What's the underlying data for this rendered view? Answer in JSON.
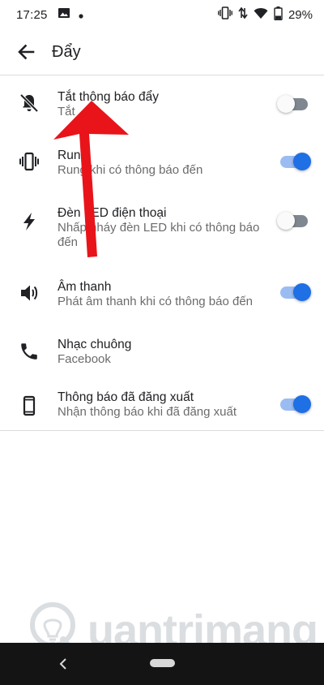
{
  "status_bar": {
    "time": "17:25",
    "left_icons": [
      "image-icon",
      "dot-icon"
    ],
    "right_icons": [
      "vibrate-icon",
      "data-arrows-icon",
      "wifi-icon",
      "battery-icon"
    ],
    "battery": "29%"
  },
  "app_bar": {
    "title": "Đẩy",
    "back_icon": "back-arrow-icon"
  },
  "settings": [
    {
      "icon": "bell-off-icon",
      "title": "Tắt thông báo đẩy",
      "subtitle": "Tắt",
      "toggle": "off"
    },
    {
      "icon": "vibrate-icon",
      "title": "Rung",
      "subtitle": "Rung khi có thông báo đến",
      "toggle": "on"
    },
    {
      "icon": "flash-icon",
      "title": "Đèn LED điện thoại",
      "subtitle": "Nhấp nháy đèn LED khi có thông báo đến",
      "toggle": "off"
    },
    {
      "icon": "speaker-icon",
      "title": "Âm thanh",
      "subtitle": "Phát âm thanh khi có thông báo đến",
      "toggle": "on"
    },
    {
      "icon": "phone-icon",
      "title": "Nhạc chuông",
      "subtitle": "Facebook",
      "toggle": null
    },
    {
      "icon": "smartphone-icon",
      "title": "Thông báo đã đăng xuất",
      "subtitle": "Nhận thông báo khi đã đăng xuất",
      "toggle": "on"
    }
  ],
  "watermark": {
    "text": "uantrimang"
  },
  "colors": {
    "toggle_on_thumb": "#1f6fe5",
    "toggle_on_track": "#9bbcf3",
    "toggle_off_track": "#7f8790",
    "annotation_arrow": "#e8141a"
  }
}
